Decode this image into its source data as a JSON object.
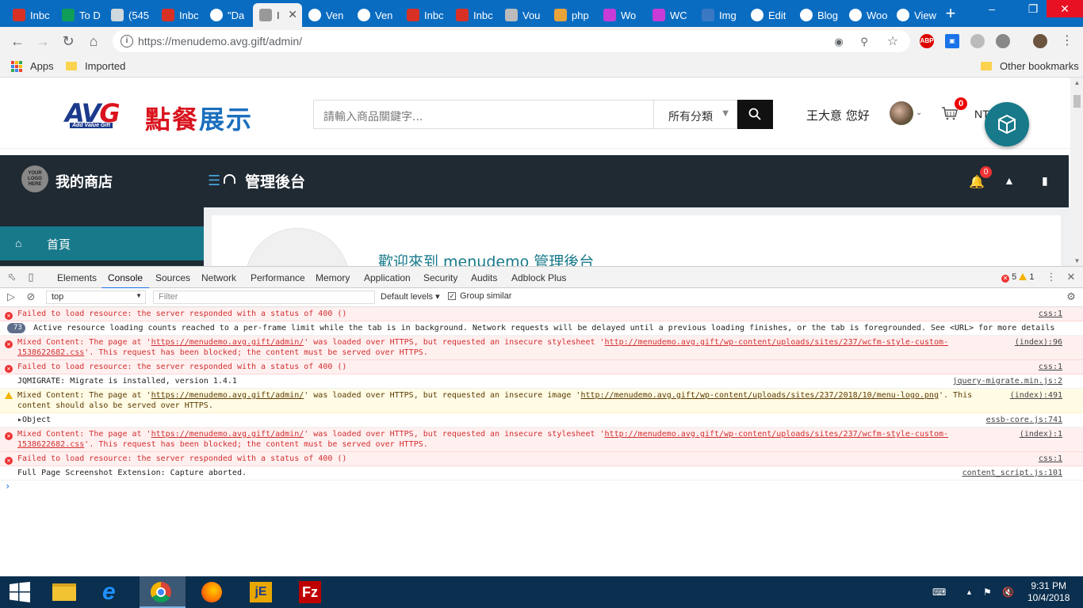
{
  "browser": {
    "tabs": [
      {
        "label": "Inbc",
        "icon": "gmail-icon",
        "color": "#d93025"
      },
      {
        "label": "To D",
        "icon": "sheets-icon",
        "color": "#0f9d58"
      },
      {
        "label": "(545",
        "icon": "mail-icon",
        "color": "#cfd8dc"
      },
      {
        "label": "Inbc",
        "icon": "gmail-icon",
        "color": "#d93025"
      },
      {
        "label": "\"Da",
        "icon": "wp-icon",
        "color": "#fff"
      },
      {
        "label": "I",
        "icon": "page-icon",
        "color": "#999",
        "active": true
      },
      {
        "label": "Ven",
        "icon": "wp-icon",
        "color": "#fff"
      },
      {
        "label": "Ven",
        "icon": "wp-icon",
        "color": "#fff"
      },
      {
        "label": "Inbc",
        "icon": "gmail-icon",
        "color": "#d93025"
      },
      {
        "label": "Inbc",
        "icon": "gmail-icon",
        "color": "#d93025"
      },
      {
        "label": "Vou",
        "icon": "page-icon",
        "color": "#bbb"
      },
      {
        "label": "php",
        "icon": "php-icon",
        "color": "#e8a33a"
      },
      {
        "label": "Wo",
        "icon": "woo-icon",
        "color": "#c73cd6"
      },
      {
        "label": "WC",
        "icon": "woo-icon",
        "color": "#c73cd6"
      },
      {
        "label": "Img",
        "icon": "ibb-icon",
        "color": "#3b78c4"
      },
      {
        "label": "Edit",
        "icon": "wp-icon",
        "color": "#fff"
      },
      {
        "label": "Blog",
        "icon": "wp-icon",
        "color": "#fff"
      },
      {
        "label": "Woo",
        "icon": "wordpress-icon",
        "color": "#fff"
      },
      {
        "label": "View",
        "icon": "wordpress-icon",
        "color": "#fff"
      }
    ],
    "url": "https://menudemo.avg.gift/admin/",
    "bookmarks": {
      "apps": "Apps",
      "imported": "Imported",
      "other": "Other bookmarks"
    }
  },
  "site": {
    "logo_text": "AV",
    "logo_g": "G",
    "logo_sub": "Add Value Gift",
    "logo_cn_red": "點餐",
    "logo_cn_blue": "展示",
    "search_placeholder": "請輸入商品關鍵字...",
    "category": "所有分類",
    "greeting": "王大意 您好",
    "cart_count": "0",
    "cart_total": "NT$0"
  },
  "admin": {
    "logo_text": "YOUR LOGO HERE",
    "shop_name": "我的商店",
    "title": "管理後台",
    "notif_count": "0",
    "sidebar_home": "首頁",
    "welcome": "歡迎來到 menudemo 管理後台"
  },
  "devtools": {
    "tabs": [
      "Elements",
      "Console",
      "Sources",
      "Network",
      "Performance",
      "Memory",
      "Application",
      "Security",
      "Audits",
      "Adblock Plus"
    ],
    "active_tab": "Console",
    "error_count": "5",
    "warning_count": "1",
    "context": "top",
    "filter_placeholder": "Filter",
    "levels": "Default levels ▾",
    "group_similar": "Group similar",
    "messages": [
      {
        "level": "error",
        "text": "Failed to load resource: the server responded with a status of 400 ()",
        "source": "css:1"
      },
      {
        "level": "info",
        "badge": "73",
        "text": "Active resource loading counts reached to a per-frame limit while the tab is in background. Network requests will be delayed until a previous loading finishes, or the tab is foregrounded. See <URL> for more details",
        "source": ""
      },
      {
        "level": "error",
        "text_pre": "Mixed Content: The page at '",
        "link1": "https://menudemo.avg.gift/admin/",
        "text_mid": "' was loaded over HTTPS, but requested an insecure stylesheet '",
        "link2": "http://menudemo.avg.gift/wp-content/uploads/sites/237/wcfm-style-custom-1538622682.css",
        "text_post": "'. This request has been blocked; the content must be served over HTTPS.",
        "source": "(index):96"
      },
      {
        "level": "error",
        "text": "Failed to load resource: the server responded with a status of 400 ()",
        "source": "css:1"
      },
      {
        "level": "info",
        "text": "JQMIGRATE: Migrate is installed, version 1.4.1",
        "source": "jquery-migrate.min.js:2"
      },
      {
        "level": "warn",
        "text_pre": "Mixed Content: The page at '",
        "link1": "https://menudemo.avg.gift/admin/",
        "text_mid": "' was loaded over HTTPS, but requested an insecure image '",
        "link2": "http://menudemo.avg.gift/wp-content/uploads/sites/237/2018/10/menu-logo.png",
        "text_post": "'. This content should also be served over HTTPS.",
        "source": "(index):491"
      },
      {
        "level": "info",
        "text": "▸Object",
        "source": "essb-core.js:741"
      },
      {
        "level": "error",
        "text_pre": "Mixed Content: The page at '",
        "link1": "https://menudemo.avg.gift/admin/",
        "text_mid": "' was loaded over HTTPS, but requested an insecure stylesheet '",
        "link2": "http://menudemo.avg.gift/wp-content/uploads/sites/237/wcfm-style-custom-1538622682.css",
        "text_post": "'. This request has been blocked; the content must be served over HTTPS.",
        "source": "(index):1"
      },
      {
        "level": "error",
        "text": "Failed to load resource: the server responded with a status of 400 ()",
        "source": "css:1"
      },
      {
        "level": "info",
        "text": "Full Page Screenshot Extension: Capture aborted.",
        "source": "content_script.js:101"
      }
    ]
  },
  "taskbar": {
    "time": "9:31 PM",
    "date": "10/4/2018",
    "apps": [
      "explorer-icon",
      "ie-icon",
      "chrome-icon",
      "firefox-icon",
      "jedit-icon",
      "filezilla-icon"
    ]
  }
}
